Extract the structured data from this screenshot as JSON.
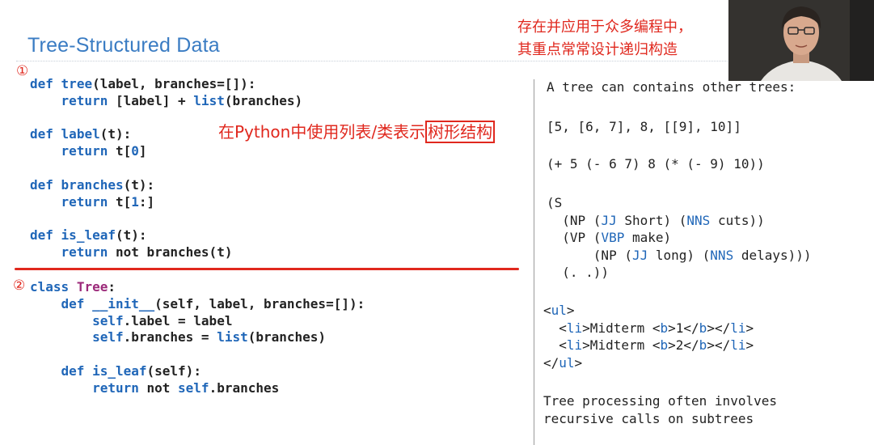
{
  "slide": {
    "title": "Tree-Structured Data"
  },
  "annotations": {
    "marker1": "①",
    "marker2": "②",
    "inline_prefix": "在Python中使用列表/类表示",
    "inline_boxed": "树形结构",
    "top_note_line1": "存在并应用于众多编程中，",
    "top_note_line2": "其重点常常设计递归构造"
  },
  "left_code": {
    "section1": [
      "def tree(label, branches=[]):",
      "    return [label] + list(branches)",
      "",
      "def label(t):",
      "    return t[0]",
      "",
      "def branches(t):",
      "    return t[1:]",
      "",
      "def is_leaf(t):",
      "    return not branches(t)"
    ],
    "section2": [
      "class Tree:",
      "    def __init__(self, label, branches=[]):",
      "        self.label = label",
      "        self.branches = list(branches)",
      "",
      "    def is_leaf(self):",
      "        return not self.branches"
    ]
  },
  "right_panel": {
    "intro": "A tree can contains other trees:",
    "list_example": "[5, [6, 7], 8, [[9], 10]]",
    "scheme_example": "(+ 5 (- 6 7) 8 (* (- 9) 10))",
    "parse_example": [
      "(S",
      "  (NP (JJ Short) (NNS cuts))",
      "  (VP (VBP make)",
      "      (NP (JJ long) (NNS delays)))",
      "  (. .))"
    ],
    "html_example": [
      "<ul>",
      "  <li>Midterm <b>1</b></li>",
      "  <li>Midterm <b>2</b></li>",
      "</ul>"
    ],
    "closing": [
      "Tree processing often involves",
      "recursive calls on subtrees"
    ]
  },
  "colors": {
    "title_blue": "#3a7cc3",
    "annotation_red": "#e0281e",
    "keyword_blue": "#1f66b8",
    "class_purple": "#9c2a7a"
  },
  "icons": {
    "webcam": "presenter-webcam"
  }
}
